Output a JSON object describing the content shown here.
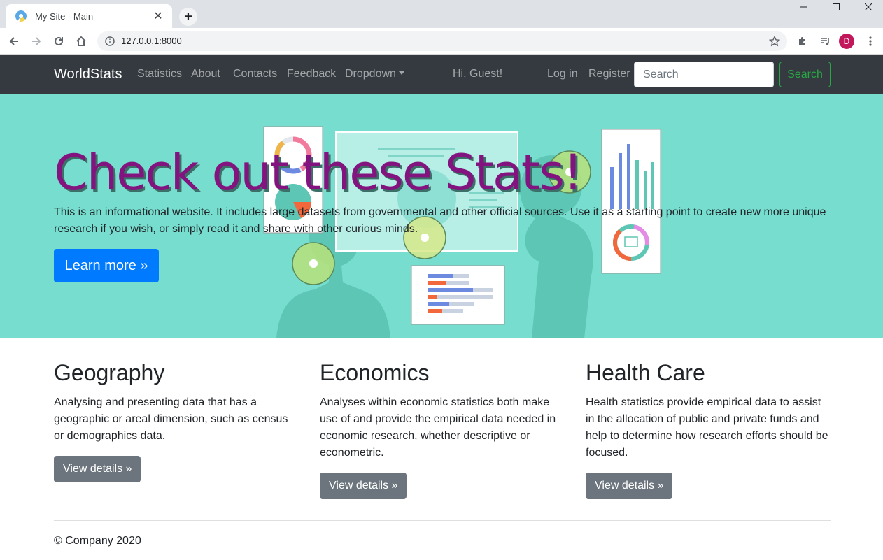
{
  "browser": {
    "tab_title": "My Site - Main",
    "url": "127.0.0.1:8000",
    "profile_initial": "D"
  },
  "navbar": {
    "brand": "WorldStats",
    "links": [
      "Statistics",
      "About",
      "Contacts",
      "Feedback",
      "Dropdown"
    ],
    "greeting": "Hi, Guest!",
    "login": "Log in",
    "register": "Register",
    "search_placeholder": "Search",
    "search_button": "Search"
  },
  "hero": {
    "title": "Check out these Stats!",
    "text": "This is an informational website. It includes large datasets from governmental and other official sources. Use it as a starting point to create new more unique research if you wish, or simply read it and share with other curious minds.",
    "button": "Learn more »"
  },
  "columns": [
    {
      "heading": "Geography",
      "text": "Analysing and presenting data that has a geographic or areal dimension, such as census or demographics data.",
      "button": "View details »"
    },
    {
      "heading": "Economics",
      "text": "Analyses within economic statistics both make use of and provide the empirical data needed in economic research, whether descriptive or econometric.",
      "button": "View details »"
    },
    {
      "heading": "Health Care",
      "text": "Health statistics provide empirical data to assist in the allocation of public and private funds and help to determine how research efforts should be focused.",
      "button": "View details »"
    }
  ],
  "footer": "© Company 2020",
  "colors": {
    "navbar_bg": "#343a40",
    "hero_bg": "#76ddcf",
    "hero_title": "#82137f",
    "primary": "#007bff",
    "secondary": "#6c757d",
    "success": "#28a745"
  }
}
